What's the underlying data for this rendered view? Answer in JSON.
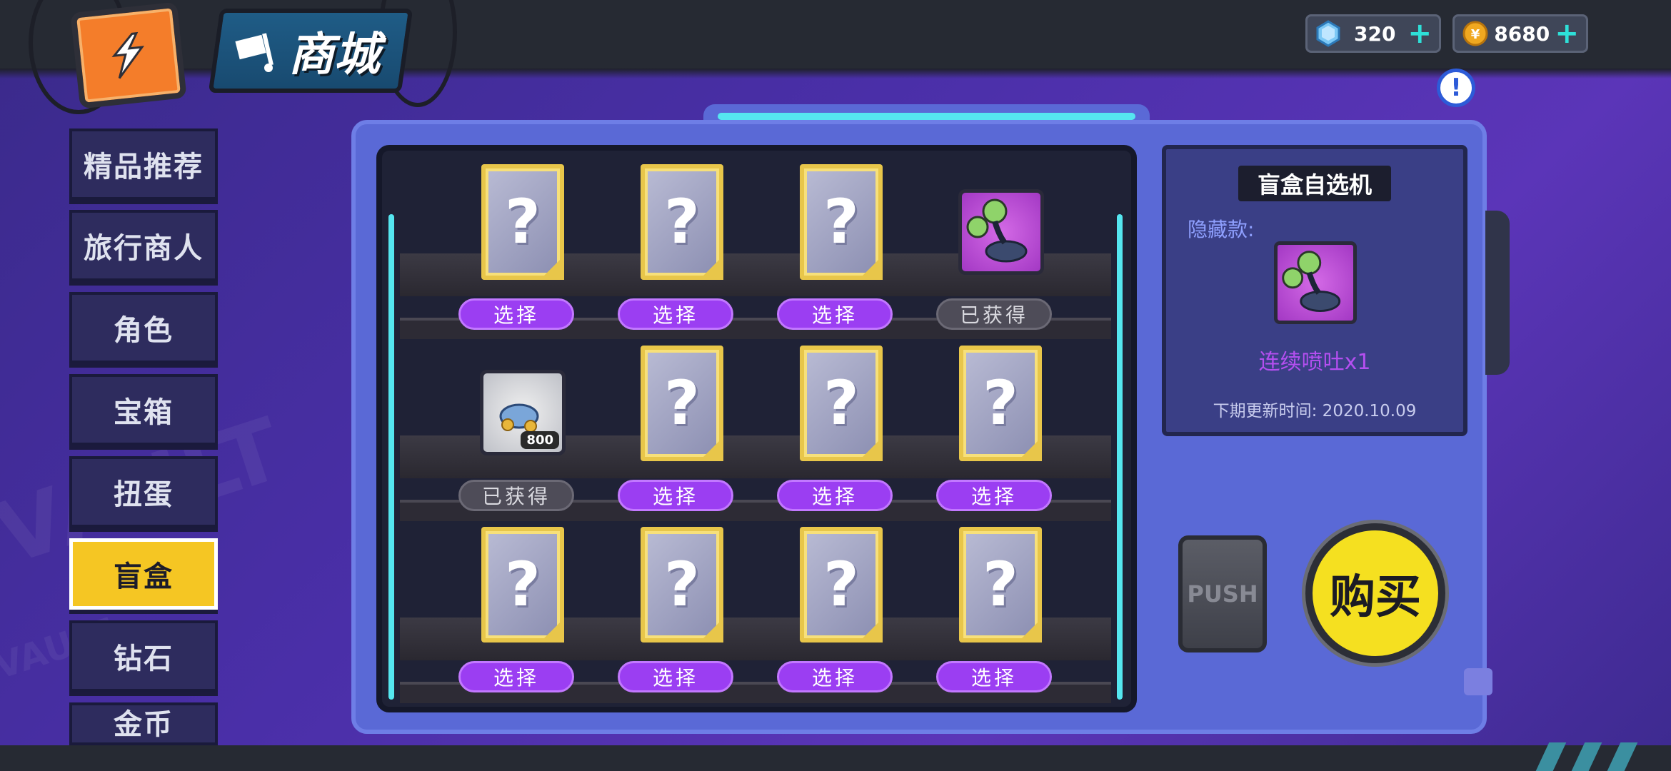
{
  "header": {
    "title": "商城",
    "back_icon": "back-arrow-icon"
  },
  "currency": {
    "gems": {
      "value": "320",
      "icon": "gem-icon"
    },
    "coins": {
      "value": "8680",
      "icon": "coin-icon"
    },
    "plus": "+"
  },
  "info_icon": "!",
  "sidebar": {
    "items": [
      {
        "label": "精品推荐",
        "active": false
      },
      {
        "label": "旅行商人",
        "active": false
      },
      {
        "label": "角色",
        "active": false
      },
      {
        "label": "宝箱",
        "active": false
      },
      {
        "label": "扭蛋",
        "active": false
      },
      {
        "label": "盲盒",
        "active": true
      },
      {
        "label": "钻石",
        "active": false
      },
      {
        "label": "金币",
        "active": false
      }
    ]
  },
  "shelves": {
    "rows": [
      [
        {
          "type": "mystery",
          "button": "选择"
        },
        {
          "type": "mystery",
          "button": "选择"
        },
        {
          "type": "mystery",
          "button": "选择"
        },
        {
          "type": "character",
          "button": "已获得"
        }
      ],
      [
        {
          "type": "item",
          "badge": "800",
          "button": "已获得"
        },
        {
          "type": "mystery",
          "button": "选择"
        },
        {
          "type": "mystery",
          "button": "选择"
        },
        {
          "type": "mystery",
          "button": "选择"
        }
      ],
      [
        {
          "type": "mystery",
          "button": "选择"
        },
        {
          "type": "mystery",
          "button": "选择"
        },
        {
          "type": "mystery",
          "button": "选择"
        },
        {
          "type": "mystery",
          "button": "选择"
        }
      ]
    ],
    "mystery_glyph": "?"
  },
  "panel": {
    "title": "盲盒自选机",
    "hidden_label": "隐藏款:",
    "reward_name": "连续喷吐x1",
    "next_update": "下期更新时间: 2020.10.09"
  },
  "push_label": "PUSH",
  "buy_label": "购买",
  "watermarks": [
    "VAULT",
    "VAULT"
  ],
  "colors": {
    "accent_purple": "#9b3ef2",
    "active_tab": "#f5c623",
    "neon": "#55e6f0",
    "buy": "#f5e020"
  }
}
